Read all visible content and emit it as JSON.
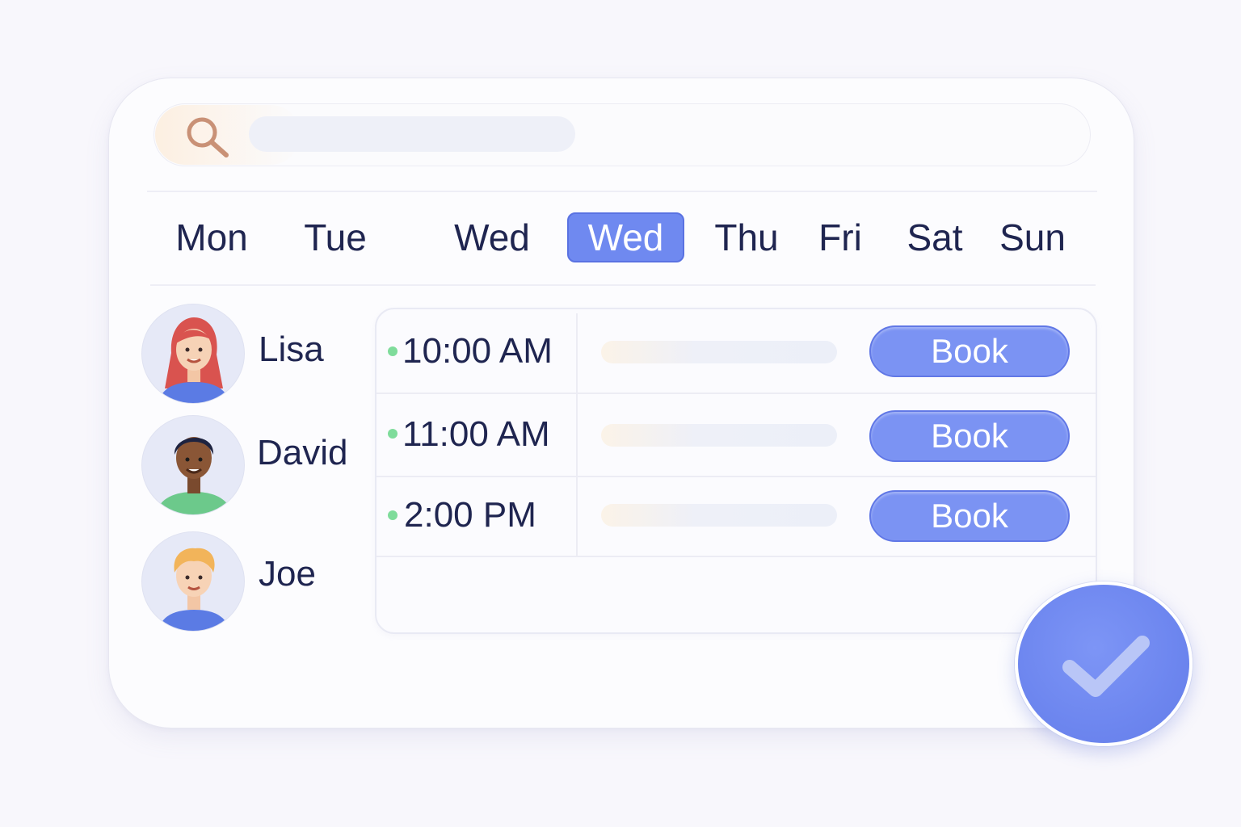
{
  "search": {
    "placeholder": "",
    "value": ""
  },
  "days": [
    {
      "label": "Mon",
      "active": false
    },
    {
      "label": "Tue",
      "active": false
    },
    {
      "label": "Wed",
      "active": false
    },
    {
      "label": "Wed",
      "active": true
    },
    {
      "label": "Thu",
      "active": false
    },
    {
      "label": "Fri",
      "active": false
    },
    {
      "label": "Sat",
      "active": false
    },
    {
      "label": "Sun",
      "active": false
    }
  ],
  "people": [
    {
      "name": "Lisa",
      "avatar": "avatar-woman-red-hair"
    },
    {
      "name": "David",
      "avatar": "avatar-man-dark-hair"
    },
    {
      "name": "Joe",
      "avatar": "avatar-boy-blond-hair"
    }
  ],
  "slots": [
    {
      "time": "10:00 AM",
      "status": "available",
      "book_label": "Book"
    },
    {
      "time": "11:00 AM",
      "status": "available",
      "book_label": "Book"
    },
    {
      "time": "2:00 PM",
      "status": "available",
      "book_label": "Book"
    }
  ],
  "colors": {
    "accent": "#6f89f0",
    "button": "#7b93f3",
    "available_dot": "#7fdc9b",
    "text": "#1f2550",
    "background": "#f8f7fc"
  },
  "icons": {
    "search": "search-icon",
    "confirm": "check-icon"
  }
}
